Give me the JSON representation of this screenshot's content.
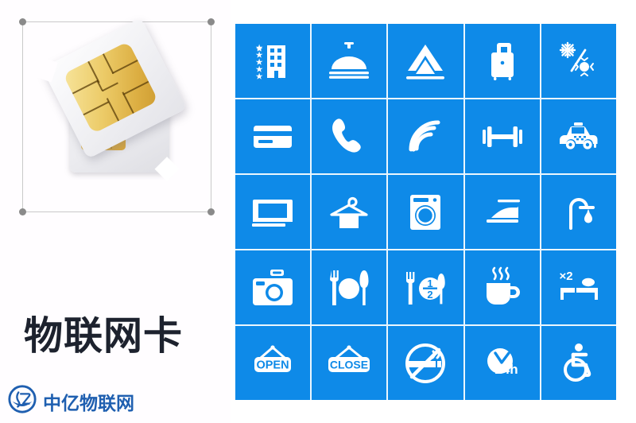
{
  "left_panel": {
    "product_title": "物联网卡",
    "image_alt": "sim-card-product-photo",
    "selection": {
      "handles": [
        "top-left",
        "top-right",
        "bottom-left",
        "bottom-right"
      ]
    },
    "watermark": {
      "logo_icon": "circular-brand-emblem",
      "text": "中亿物联网",
      "color": "#1f5fb0"
    }
  },
  "icon_grid": {
    "columns": 5,
    "rows": 5,
    "tile_color": "#0e8ae8",
    "icon_color": "#ffffff",
    "gap_color": "#eaf6fe",
    "tiles": [
      {
        "name": "hotel-star-rating-icon",
        "label": "Hotel",
        "row": 1,
        "col": 1
      },
      {
        "name": "room-service-icon",
        "label": "Room service",
        "row": 1,
        "col": 2
      },
      {
        "name": "mountain-peak-icon",
        "label": "Mountain view",
        "row": 1,
        "col": 3
      },
      {
        "name": "luggage-icon",
        "label": "Luggage storage",
        "row": 1,
        "col": 4
      },
      {
        "name": "air-conditioning-icon",
        "label": "Air conditioning",
        "row": 1,
        "col": 5
      },
      {
        "name": "credit-card-icon",
        "label": "Card payment",
        "row": 2,
        "col": 1
      },
      {
        "name": "telephone-icon",
        "label": "Telephone",
        "row": 2,
        "col": 2
      },
      {
        "name": "wifi-icon",
        "label": "Wi-Fi",
        "row": 2,
        "col": 3
      },
      {
        "name": "dumbbell-gym-icon",
        "label": "Gym",
        "row": 2,
        "col": 4
      },
      {
        "name": "taxi-icon",
        "label": "Taxi",
        "row": 2,
        "col": 5
      },
      {
        "name": "television-icon",
        "label": "Television",
        "row": 3,
        "col": 1
      },
      {
        "name": "clothes-hanger-icon",
        "label": "Laundry",
        "row": 3,
        "col": 2
      },
      {
        "name": "washing-machine-icon",
        "label": "Washing machine",
        "row": 3,
        "col": 3
      },
      {
        "name": "iron-icon",
        "label": "Ironing",
        "row": 3,
        "col": 4
      },
      {
        "name": "shower-icon",
        "label": "Shower",
        "row": 3,
        "col": 5
      },
      {
        "name": "camera-icon",
        "label": "Photography",
        "row": 4,
        "col": 1
      },
      {
        "name": "restaurant-cutlery-icon",
        "label": "Restaurant",
        "row": 4,
        "col": 2
      },
      {
        "name": "half-board-icon",
        "label": "Half board",
        "row": 4,
        "col": 3,
        "badge": "1/2"
      },
      {
        "name": "hot-coffee-cup-icon",
        "label": "Coffee",
        "row": 4,
        "col": 4
      },
      {
        "name": "double-bed-icon",
        "label": "Double bed",
        "row": 4,
        "col": 5,
        "badge": "x2"
      },
      {
        "name": "open-sign-icon",
        "label": "Open",
        "row": 5,
        "col": 1,
        "badge": "OPEN"
      },
      {
        "name": "close-sign-icon",
        "label": "Close",
        "row": 5,
        "col": 2,
        "badge": "CLOSE"
      },
      {
        "name": "no-smoking-icon",
        "label": "No smoking",
        "row": 5,
        "col": 3
      },
      {
        "name": "24-hour-service-icon",
        "label": "24 hour service",
        "row": 5,
        "col": 4,
        "badge": "24h"
      },
      {
        "name": "wheelchair-accessible-icon",
        "label": "Accessible",
        "row": 5,
        "col": 5
      }
    ]
  }
}
